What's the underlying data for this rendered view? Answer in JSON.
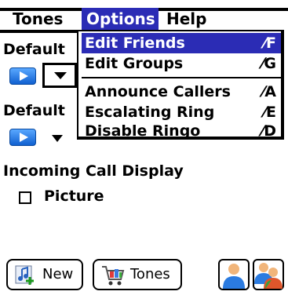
{
  "menubar": {
    "items": [
      {
        "label": "Tones"
      },
      {
        "label": "Options"
      },
      {
        "label": "Help"
      }
    ]
  },
  "dropdown": {
    "items": [
      {
        "label": "Edit Friends",
        "shortcut": "⁄F"
      },
      {
        "label": "Edit Groups",
        "shortcut": "⁄G"
      },
      {
        "label": "Announce Callers",
        "shortcut": "⁄A"
      },
      {
        "label": "Escalating Ring",
        "shortcut": "⁄E"
      },
      {
        "label": "Disable Ringo",
        "shortcut": "⁄D"
      }
    ]
  },
  "form": {
    "default1": "Default",
    "default2": "Default",
    "incoming_call_display": "Incoming Call Display",
    "picture_label": "Picture"
  },
  "buttons": {
    "new": "New",
    "tones": "Tones"
  },
  "icons": {
    "play": "play-icon",
    "new": "music-note-add-icon",
    "tones": "shopping-cart-icon",
    "person": "person-icon",
    "group": "group-icon"
  },
  "colors": {
    "menu_highlight": "#2b2cb5",
    "play_button": "#1a74e8"
  }
}
